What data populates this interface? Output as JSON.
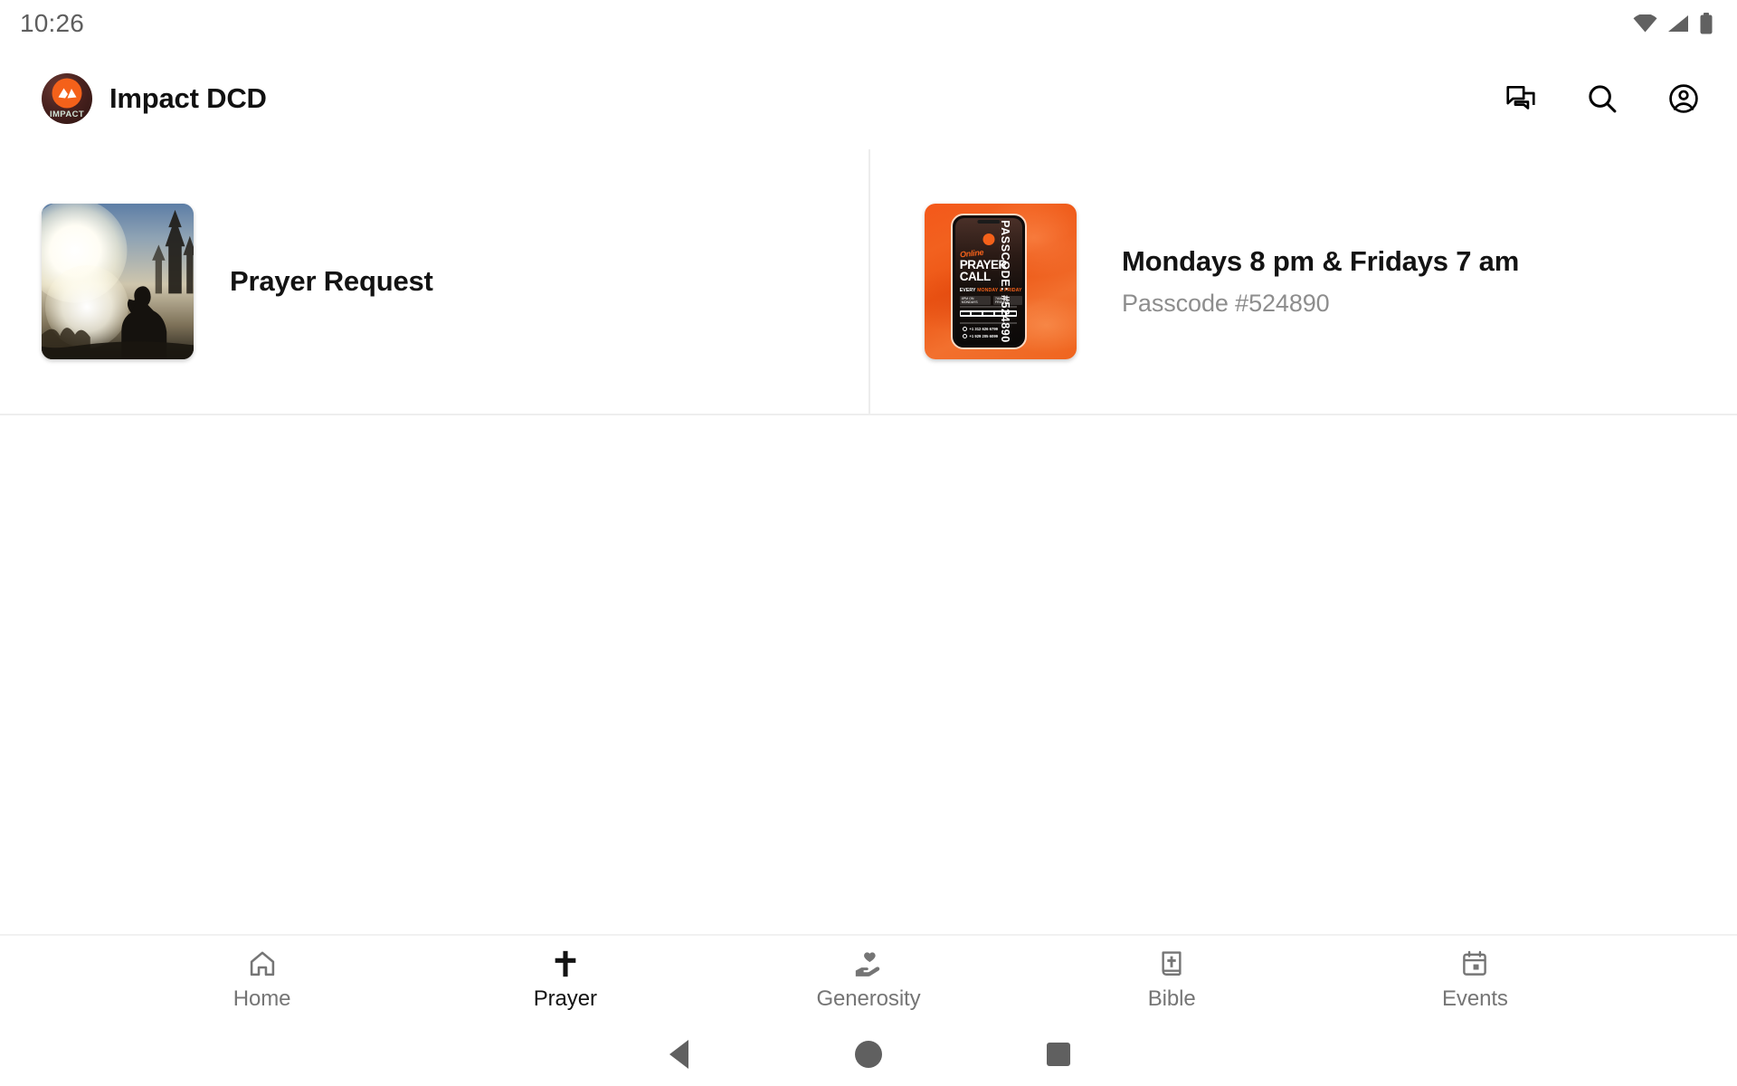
{
  "status_bar": {
    "clock": "10:26",
    "icons": [
      "wifi-icon",
      "cellular-signal-icon",
      "battery-icon"
    ]
  },
  "app_bar": {
    "logo_word": "IMPACT",
    "title": "Impact DCD",
    "actions": [
      {
        "name": "messages-icon",
        "label": "Messages"
      },
      {
        "name": "search-icon",
        "label": "Search"
      },
      {
        "name": "account-icon",
        "label": "Account"
      }
    ]
  },
  "tiles": [
    {
      "title": "Prayer Request",
      "subtitle": "",
      "thumb": "praying-silhouette-photo"
    },
    {
      "title": "Mondays 8 pm & Fridays 7 am",
      "subtitle": "Passcode #524890",
      "thumb": "online-prayer-call-flyer",
      "flyer": {
        "online": "Online",
        "title_line1": "PRAYER",
        "title_line2": "CALL",
        "every": "EVERY",
        "days": "MONDAY & FRIDAY",
        "time_badge_1": "8PM ON MONDAYS",
        "time_badge_2": "7AM ON FRIDAYS",
        "meeting_label": "DIAL ANY OF THESE NUMBERS",
        "zoom_label": "ZOOM",
        "phone_1": "+1 312 626 6799",
        "phone_2": "+1 929 205 6099",
        "passcode_vertical": "PASSCODE: #524890"
      }
    }
  ],
  "bottom_nav": {
    "items": [
      {
        "label": "Home",
        "icon": "home-icon",
        "active": false
      },
      {
        "label": "Prayer",
        "icon": "cross-icon",
        "active": true
      },
      {
        "label": "Generosity",
        "icon": "volunteer-hand-heart-icon",
        "active": false
      },
      {
        "label": "Bible",
        "icon": "bible-book-icon",
        "active": false
      },
      {
        "label": "Events",
        "icon": "calendar-icon",
        "active": false
      }
    ]
  },
  "system_nav": {
    "back": "Back",
    "home": "Home",
    "recents": "Recent apps"
  },
  "colors": {
    "brand_orange": "#f4611a",
    "text_primary": "#131313",
    "text_secondary": "#8d8d8d",
    "nav_inactive": "#757575",
    "divider": "#eeeeee"
  }
}
